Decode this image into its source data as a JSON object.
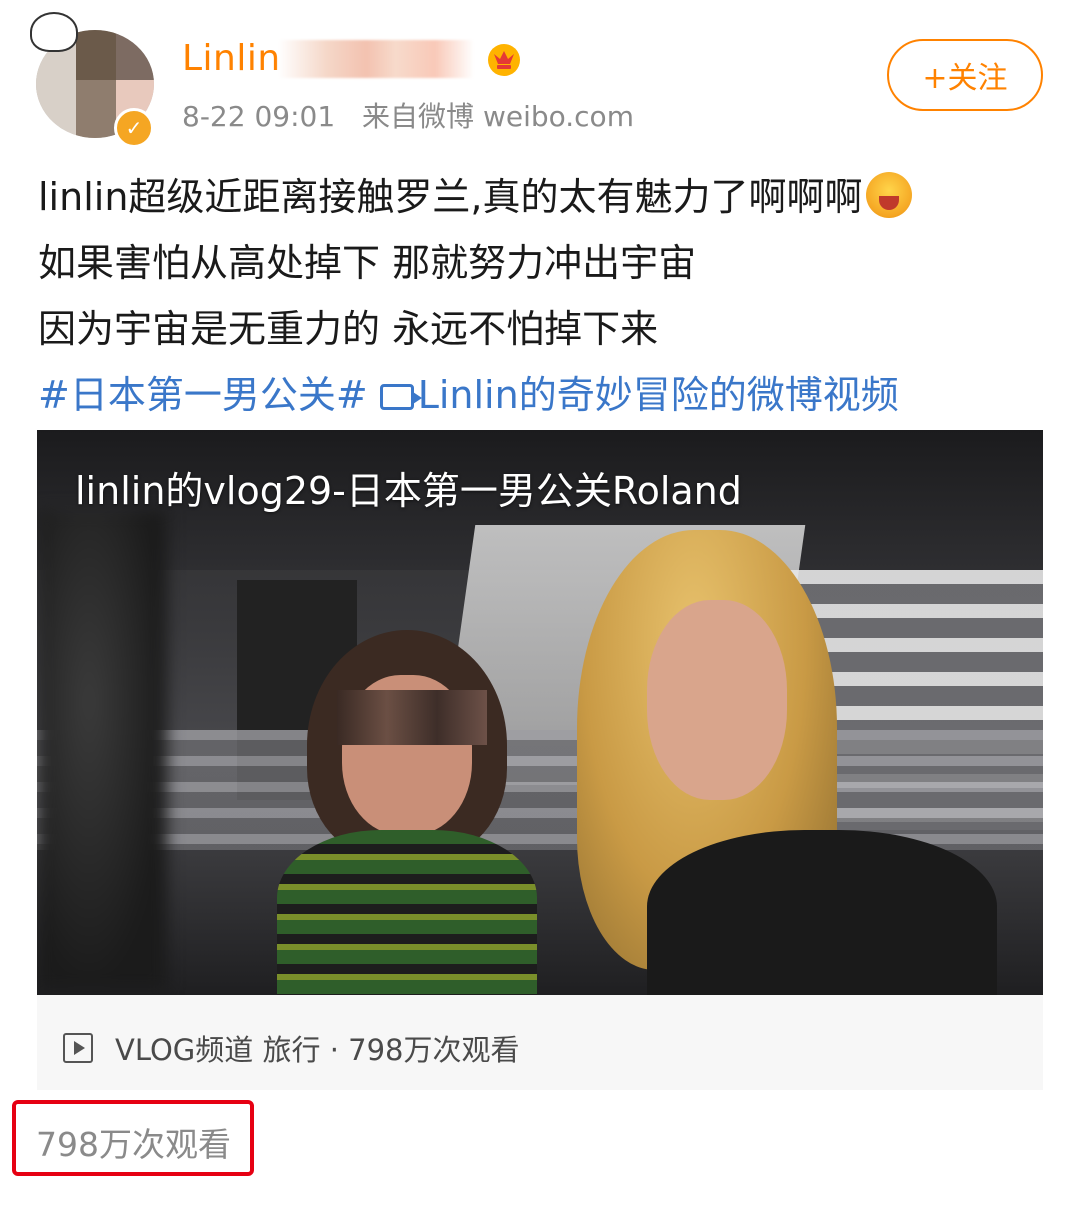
{
  "post": {
    "username": "Linlin",
    "timestamp": "8-22 09:01",
    "source": "来自微博 weibo.com",
    "follow_label": "+关注",
    "text_lines": [
      "linlin超级近距离接触罗兰,真的太有魅力了啊啊啊",
      "如果害怕从高处掉下 那就努力冲出宇宙",
      "因为宇宙是无重力的 永远不怕掉下来"
    ],
    "hashtag": "#日本第一男公关#",
    "video_link": "Linlin的奇妙冒险的微博视频",
    "emoji_icon": "crying-face-emoji",
    "badge_icon": "vip-crown-icon",
    "accent_color": "#ff8200",
    "link_color": "#3a77c9"
  },
  "video": {
    "title": "linlin的vlog29-日本第一男公关Roland",
    "info": "VLOG频道 旅行 · 798万次观看"
  },
  "footer": {
    "view_count": "798万次观看",
    "highlight_color": "#e60012"
  }
}
